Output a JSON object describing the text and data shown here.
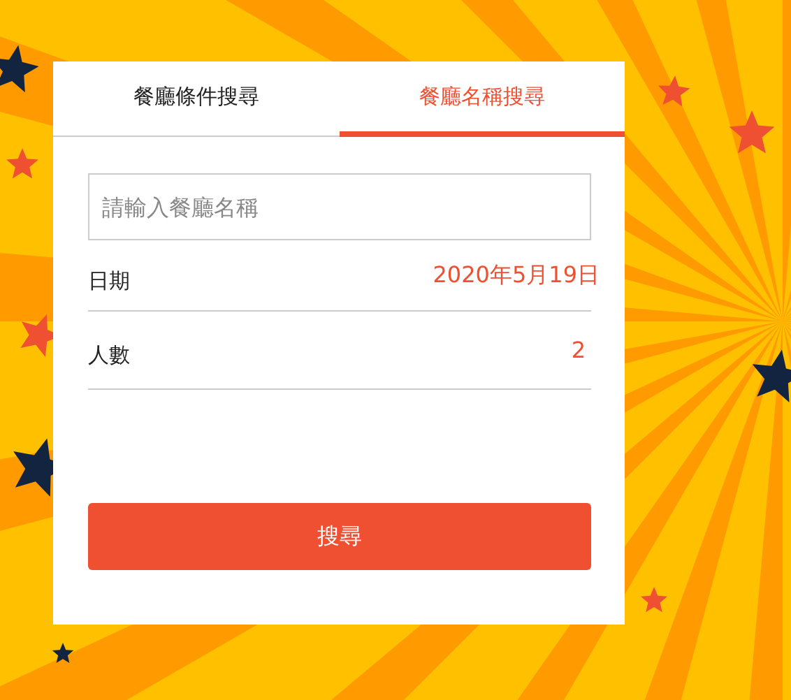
{
  "tabs": [
    {
      "label": "餐廳條件搜尋",
      "selected": false
    },
    {
      "label": "餐廳名稱搜尋",
      "selected": true
    }
  ],
  "search": {
    "placeholder": "請輸入餐廳名稱"
  },
  "fields": [
    {
      "label": "日期",
      "value": "2020年5月19日"
    },
    {
      "label": "人數",
      "value": "2"
    }
  ],
  "button": "搜尋"
}
